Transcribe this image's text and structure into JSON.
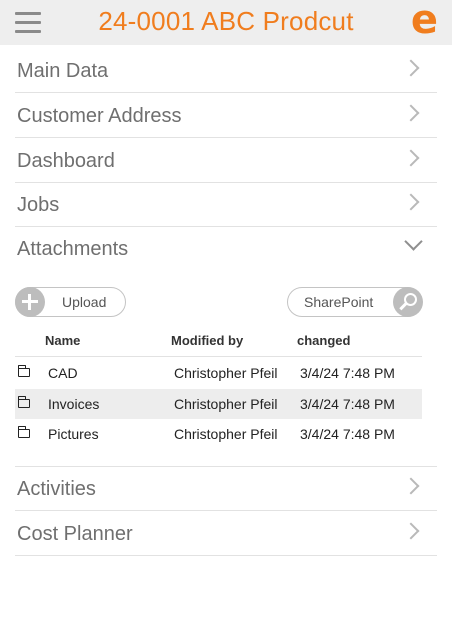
{
  "header": {
    "title": "24-0001 ABC Prodcut",
    "brand_letter": "e",
    "accent_color": "#f07d1e",
    "menu_icon": "hamburger-menu-icon"
  },
  "sections_top": [
    {
      "label": "Main Data"
    },
    {
      "label": "Customer Address"
    },
    {
      "label": "Dashboard"
    },
    {
      "label": "Jobs"
    }
  ],
  "attachments": {
    "label": "Attachments",
    "expanded": true,
    "upload_label": "Upload",
    "sharepoint_label": "SharePoint",
    "columns": {
      "name": "Name",
      "modified_by": "Modified by",
      "changed": "changed"
    },
    "rows": [
      {
        "name": "CAD",
        "modified_by": "Christopher Pfeil",
        "changed": "3/4/24 7:48 PM",
        "icon": "folder-icon"
      },
      {
        "name": "Invoices",
        "modified_by": "Christopher Pfeil",
        "changed": "3/4/24 7:48 PM",
        "icon": "folder-icon",
        "highlighted": true
      },
      {
        "name": "Pictures",
        "modified_by": "Christopher Pfeil",
        "changed": "3/4/24 7:48 PM",
        "icon": "folder-icon"
      }
    ]
  },
  "sections_bottom": [
    {
      "label": "Activities"
    },
    {
      "label": "Cost Planner"
    }
  ]
}
